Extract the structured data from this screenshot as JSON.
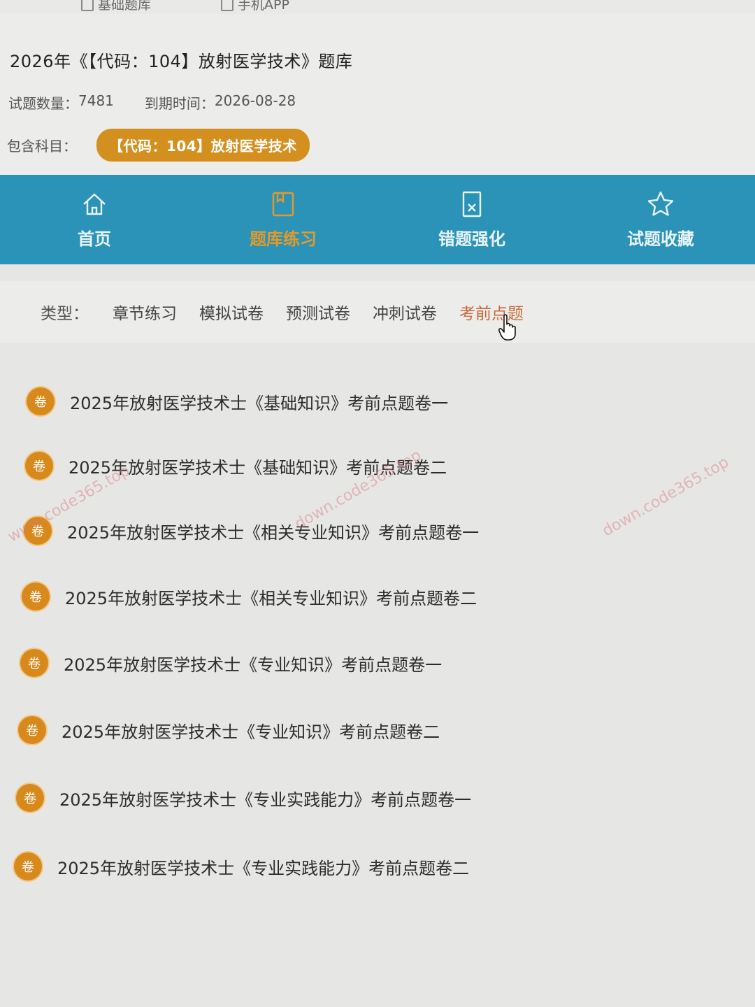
{
  "top_links": [
    {
      "label": "基础题库"
    },
    {
      "label": "手机APP"
    }
  ],
  "bank": {
    "title": "2026年《【代码：104】放射医学技术》题库",
    "question_count_label": "试题数量：",
    "question_count": "7481",
    "expiry_label": "到期时间：",
    "expiry_date": "2026-08-28",
    "subjects_label": "包含科目：",
    "subject": "【代码：104】放射医学技术"
  },
  "nav": [
    {
      "label": "首页",
      "icon": "home-icon",
      "active": false
    },
    {
      "label": "题库练习",
      "icon": "book-icon",
      "active": true
    },
    {
      "label": "错题强化",
      "icon": "wrong-doc-icon",
      "active": false
    },
    {
      "label": "试题收藏",
      "icon": "star-icon",
      "active": false
    }
  ],
  "types": {
    "label": "类型：",
    "tabs": [
      {
        "label": "章节练习",
        "active": false
      },
      {
        "label": "模拟试卷",
        "active": false
      },
      {
        "label": "预测试卷",
        "active": false
      },
      {
        "label": "冲刺试卷",
        "active": false
      },
      {
        "label": "考前点题",
        "active": true
      }
    ]
  },
  "papers": {
    "badge": "卷",
    "items": [
      "2025年放射医学技术士《基础知识》考前点题卷一",
      "2025年放射医学技术士《基础知识》考前点题卷二",
      "2025年放射医学技术士《相关专业知识》考前点题卷一",
      "2025年放射医学技术士《相关专业知识》考前点题卷二",
      "2025年放射医学技术士《专业知识》考前点题卷一",
      "2025年放射医学技术士《专业知识》考前点题卷二",
      "2025年放射医学技术士《专业实践能力》考前点题卷一",
      "2025年放射医学技术士《专业实践能力》考前点题卷二"
    ]
  },
  "watermarks": [
    "www.code365.top",
    "down.code365.top",
    "down.code365.top"
  ],
  "colors": {
    "nav_bg": "#2b93b8",
    "accent_orange": "#d8891c",
    "active_tab": "#c86a3c"
  }
}
